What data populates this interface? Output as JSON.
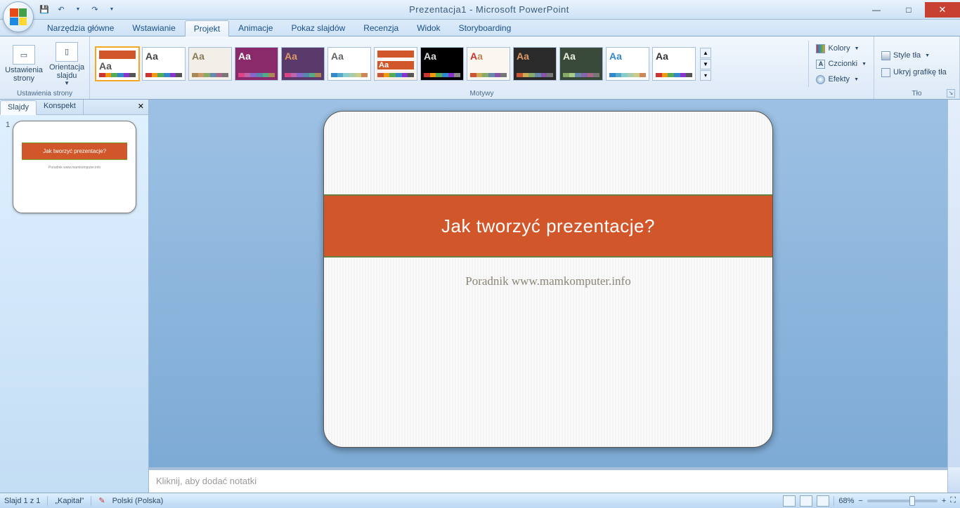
{
  "window": {
    "title": "Prezentacja1 - Microsoft PowerPoint"
  },
  "qat": {
    "save": "💾",
    "undo": "↶",
    "redo": "↷"
  },
  "tabs": [
    "Narzędzia główne",
    "Wstawianie",
    "Projekt",
    "Animacje",
    "Pokaz slajdów",
    "Recenzja",
    "Widok",
    "Storyboarding"
  ],
  "active_tab_index": 2,
  "ribbon": {
    "group_page_setup": {
      "slide_setup": "Ustawienia strony",
      "orientation": "Orientacja slajdu",
      "label": "Ustawienia strony"
    },
    "group_themes": {
      "label": "Motywy",
      "colors": "Kolory",
      "fonts": "Czcionki",
      "effects": "Efekty"
    },
    "group_background": {
      "styles": "Style tła",
      "hide_graphics": "Ukryj grafikę tła",
      "label": "Tło"
    }
  },
  "left_pane": {
    "tab_slides": "Slajdy",
    "tab_outline": "Konspekt",
    "slide_number": "1"
  },
  "slide": {
    "title": "Jak tworzyć prezentacje?",
    "subtitle": "Poradnik www.mamkomputer.info"
  },
  "notes": {
    "placeholder": "Kliknij, aby dodać notatki"
  },
  "status": {
    "slide_count": "Slajd 1 z 1",
    "theme": "„Kapitał”",
    "language": "Polski (Polska)",
    "zoom": "68%",
    "zoom_minus": "−",
    "zoom_plus": "+",
    "fit_icon": "⛶"
  }
}
